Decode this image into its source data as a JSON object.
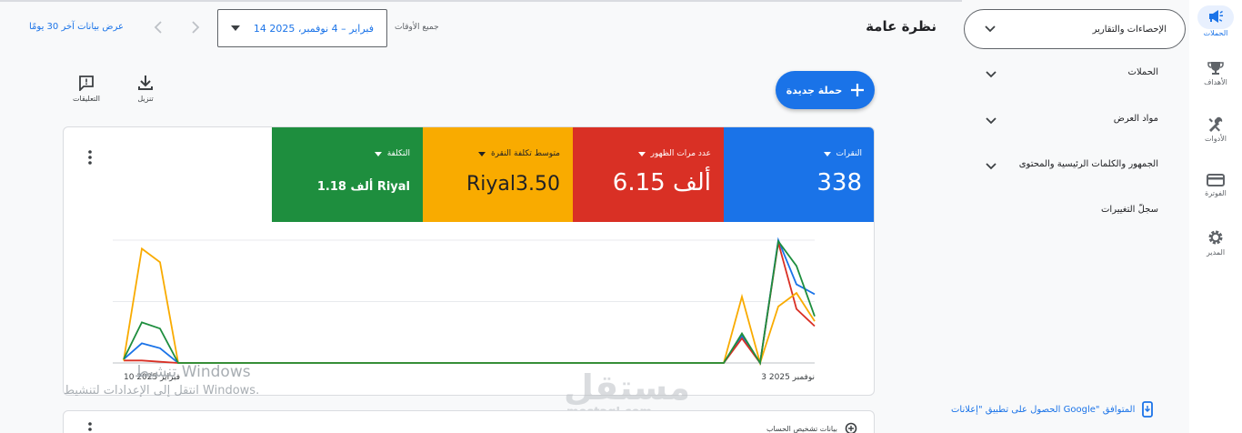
{
  "rail": {
    "items": [
      {
        "label": "الحملات",
        "icon": "campaign-icon",
        "active": true
      },
      {
        "label": "الأهداف",
        "icon": "trophy-icon"
      },
      {
        "label": "الأدوات",
        "icon": "tools-icon"
      },
      {
        "label": "الفوترة",
        "icon": "billing-card-icon"
      },
      {
        "label": "المدير",
        "icon": "gear-icon"
      }
    ]
  },
  "sidenav": {
    "selected": "الإحصاءات والتقارير",
    "items": [
      "الحملات",
      "مواد العرض",
      "الجمهور والكلمات الرئيسية والمحتوى",
      "سجلّ التغييرات"
    ],
    "app_link": "الحصول على تطبيق \"إعلانات Google\" المتوافق"
  },
  "header": {
    "title": "نظرة عامة",
    "date_label": "جميع الأوقات",
    "date_range": "14 فبراير – 4 نوفمبر، 2025",
    "last30": "عرض بيانات آخر 30 يومًا"
  },
  "actions": {
    "new_campaign": "حملة جديدة",
    "download": "تنزيل",
    "feedback": "التعليقات"
  },
  "metrics": [
    {
      "label": "النقرات",
      "value": "338",
      "color": "#1a73e8"
    },
    {
      "label": "عدد مرات الظهور",
      "value": "6.15 ألف",
      "color": "#d93025"
    },
    {
      "label": "متوسط تكلفة النقرة",
      "value": "Riyal3.50",
      "color": "#f9ab00"
    },
    {
      "label": "التكلفة",
      "value": "1.18 ألف Riyal",
      "color": "#1e8e3e"
    }
  ],
  "chart_data": {
    "type": "line",
    "x_tick_labels": [
      "10 فبراير 2025",
      "3 نوفمبر 2025"
    ],
    "y_normalized": true,
    "series": [
      {
        "color": "#1a73e8",
        "values": [
          0.03,
          0.16,
          0.12,
          0.0,
          0.0,
          0.0,
          0.0,
          0.0,
          0.0,
          0.0,
          0.0,
          0.0,
          0.0,
          0.0,
          0.0,
          0.0,
          0.0,
          0.0,
          0.0,
          0.0,
          0.0,
          0.0,
          0.0,
          0.0,
          0.0,
          0.0,
          0.0,
          0.0,
          0.0,
          0.0,
          0.0,
          0.0,
          0.0,
          0.0,
          0.22,
          0.0,
          1.0,
          0.64,
          0.56
        ]
      },
      {
        "color": "#d93025",
        "values": [
          0.02,
          0.02,
          0.01,
          0.0,
          0.0,
          0.0,
          0.0,
          0.0,
          0.0,
          0.0,
          0.0,
          0.0,
          0.0,
          0.0,
          0.0,
          0.0,
          0.0,
          0.0,
          0.0,
          0.0,
          0.0,
          0.0,
          0.0,
          0.0,
          0.0,
          0.0,
          0.0,
          0.0,
          0.0,
          0.0,
          0.0,
          0.0,
          0.0,
          0.0,
          0.2,
          0.0,
          0.98,
          0.44,
          0.3
        ]
      },
      {
        "color": "#f9ab00",
        "values": [
          0.02,
          0.93,
          0.82,
          0.0,
          0.0,
          0.0,
          0.0,
          0.0,
          0.0,
          0.0,
          0.0,
          0.0,
          0.0,
          0.0,
          0.0,
          0.0,
          0.0,
          0.0,
          0.0,
          0.0,
          0.0,
          0.0,
          0.0,
          0.0,
          0.0,
          0.0,
          0.0,
          0.0,
          0.0,
          0.0,
          0.0,
          0.0,
          0.0,
          0.0,
          0.54,
          0.0,
          0.46,
          0.57,
          0.34
        ]
      },
      {
        "color": "#1e8e3e",
        "values": [
          0.03,
          0.33,
          0.28,
          0.0,
          0.0,
          0.0,
          0.0,
          0.0,
          0.0,
          0.0,
          0.0,
          0.0,
          0.0,
          0.0,
          0.0,
          0.0,
          0.0,
          0.0,
          0.0,
          0.0,
          0.0,
          0.0,
          0.0,
          0.0,
          0.0,
          0.0,
          0.0,
          0.0,
          0.0,
          0.0,
          0.0,
          0.0,
          0.0,
          0.0,
          0.24,
          0.0,
          0.99,
          0.79,
          0.38
        ]
      }
    ]
  },
  "card2_label": "بيانات تشخيص الحساب",
  "watermark": {
    "line1": "تنشيط Windows",
    "line2": "انتقل إلى الإعدادات لتنشيط Windows.",
    "brand": "مستقل",
    "brand_sub": "mostaql.com"
  }
}
